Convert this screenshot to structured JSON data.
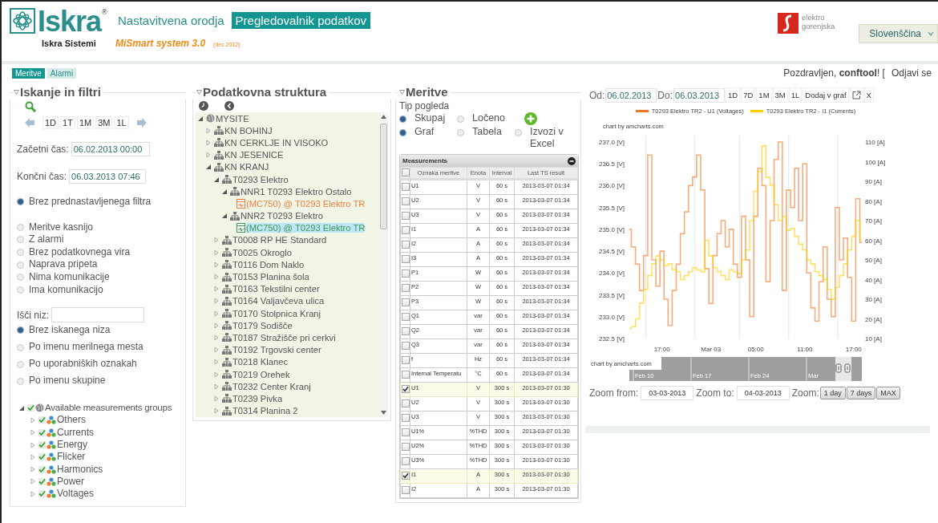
{
  "header": {
    "logo": {
      "name": "Iskra",
      "mark": "®",
      "subtitle": "Iskra Sistemi"
    },
    "tabs": [
      {
        "label": "Nastavitvena orodja",
        "selected": false
      },
      {
        "label": "Pregledovalnik podatkov",
        "selected": true
      }
    ],
    "product": "MiSmart system 3.0",
    "version": "(dec 2012)",
    "partner": [
      "elektro",
      "gorenjska"
    ],
    "language": "Slovenščina"
  },
  "nav": {
    "tabs": [
      {
        "label": "Meritve",
        "selected": true
      },
      {
        "label": "Alarmi",
        "selected": false
      }
    ],
    "greeting": "Pozdravljen, **conftool**! [",
    "logout": "Odjavi se"
  },
  "filters": {
    "title": "Iskanje in filtri",
    "period_buttons": [
      "1D",
      "1T",
      "1M",
      "3M",
      "1L"
    ],
    "start": {
      "label": "Začetni čas:",
      "value": "06.02.2013 00:00"
    },
    "end": {
      "label": "Končni čas:",
      "value": "06.03.2013 07:46"
    },
    "preset_options": [
      {
        "label": "Brez prednastavljenega filtra",
        "selected": true
      },
      {
        "label": "Meritve kasnijo",
        "selected": false
      },
      {
        "label": "Z alarmi",
        "selected": false
      },
      {
        "label": "Brez podatkovnega vira",
        "selected": false
      },
      {
        "label": "Naprava pripeta",
        "selected": false
      },
      {
        "label": "Nima komunikacije",
        "selected": false
      },
      {
        "label": "Ima komunikacijo",
        "selected": false
      }
    ],
    "search_label": "Išči niz:",
    "search_options": [
      {
        "label": "Brez iskanega niza",
        "selected": true
      },
      {
        "label": "Po imenu merilnega mesta",
        "selected": false
      },
      {
        "label": "Po uporabniških oznakah",
        "selected": false
      },
      {
        "label": "Po imenu skupine",
        "selected": false
      }
    ],
    "groups": [
      {
        "label": "Available measurements groups",
        "checked": true,
        "expanded": true,
        "children": [
          {
            "label": "Others",
            "checked": true,
            "expanded": false
          },
          {
            "label": "Currents",
            "checked": true,
            "expanded": false
          },
          {
            "label": "Energy",
            "checked": true,
            "expanded": false
          },
          {
            "label": "Flicker",
            "checked": true,
            "expanded": false
          },
          {
            "label": "Harmonics",
            "checked": true,
            "expanded": false
          },
          {
            "label": "Power",
            "checked": true,
            "expanded": false
          },
          {
            "label": "Voltages",
            "checked": true,
            "expanded": false
          }
        ]
      }
    ]
  },
  "structure": {
    "title": "Podatkovna struktura",
    "tree": [
      {
        "label": "MYSITE",
        "kind": "site",
        "expanded": true,
        "selected": false,
        "children": [
          {
            "label": "KN BOHINJ",
            "kind": "station",
            "expanded": false,
            "selected": false
          },
          {
            "label": "KN CERKLJE IN VISOKO",
            "kind": "station",
            "expanded": false,
            "selected": false
          },
          {
            "label": "KN JESENICE",
            "kind": "station",
            "expanded": false,
            "selected": false
          },
          {
            "label": "KN KRANJ",
            "kind": "station",
            "expanded": true,
            "selected": false,
            "children": [
              {
                "label": "T0293 Elektro",
                "kind": "station",
                "expanded": true,
                "selected": false,
                "children": [
                  {
                    "label": "NNR1 T0293 Elektro Ostalo",
                    "kind": "station",
                    "expanded": true,
                    "selected": false,
                    "children": [
                      {
                        "label": "(MC750) @ T0293 Elektro TR",
                        "kind": "device",
                        "color": "#f08040",
                        "selected": false
                      }
                    ]
                  },
                  {
                    "label": "NNR2 T0293 Elektro",
                    "kind": "station",
                    "expanded": true,
                    "selected": false,
                    "children": [
                      {
                        "label": "(MC750) @ T0293 Elektro TR",
                        "kind": "device",
                        "color": "#3c9a50",
                        "selected": true
                      }
                    ]
                  }
                ]
              },
              {
                "label": "T0008 RP HE Standard",
                "kind": "station",
                "expanded": false,
                "selected": false
              },
              {
                "label": "T0025 Okroglo",
                "kind": "station",
                "expanded": false,
                "selected": false
              },
              {
                "label": "T0116 Dom Naklo",
                "kind": "station",
                "expanded": false,
                "selected": false
              },
              {
                "label": "T0153 Planina šola",
                "kind": "station",
                "expanded": false,
                "selected": false
              },
              {
                "label": "T0163 Tekstilni center",
                "kind": "station",
                "expanded": false,
                "selected": false
              },
              {
                "label": "T0164 Valjavčeva ulica",
                "kind": "station",
                "expanded": false,
                "selected": false
              },
              {
                "label": "T0170 Stolpnica Kranj",
                "kind": "station",
                "expanded": false,
                "selected": false
              },
              {
                "label": "T0179 Sodišče",
                "kind": "station",
                "expanded": false,
                "selected": false
              },
              {
                "label": "T0187 Stražišče pri cerkvi",
                "kind": "station",
                "expanded": false,
                "selected": false
              },
              {
                "label": "T0192 Trgovski center",
                "kind": "station",
                "expanded": false,
                "selected": false
              },
              {
                "label": "T0218 Klanec",
                "kind": "station",
                "expanded": false,
                "selected": false
              },
              {
                "label": "T0219 Orehek",
                "kind": "station",
                "expanded": false,
                "selected": false
              },
              {
                "label": "T0232 Center Kranj",
                "kind": "station",
                "expanded": false,
                "selected": false
              },
              {
                "label": "T0239 Pivka",
                "kind": "station",
                "expanded": false,
                "selected": false
              },
              {
                "label": "T0314 Planina 2",
                "kind": "station",
                "expanded": false,
                "selected": false
              }
            ]
          }
        ]
      }
    ]
  },
  "measurements": {
    "title": "Meritve",
    "view_label": "Tip pogleda",
    "view_options": [
      {
        "label": "Skupaj",
        "selected": true
      },
      {
        "label": "Ločeno",
        "selected": false
      }
    ],
    "output_options": [
      {
        "label": "Graf",
        "selected": true
      },
      {
        "label": "Tabela",
        "selected": false
      },
      {
        "label": "Izvozi v Excel",
        "selected": false
      }
    ],
    "table": {
      "title": "Measurements",
      "header_checked": false,
      "columns": [
        "Oznaka meritve",
        "Enota",
        "Interval",
        "Last TS result"
      ],
      "rows": [
        {
          "name": "U1",
          "unit": "V",
          "interval": "60 s",
          "last": "2013-03-07 01:34",
          "checked": false
        },
        {
          "name": "U2",
          "unit": "V",
          "interval": "60 s",
          "last": "2013-03-07 01:34",
          "checked": false
        },
        {
          "name": "U3",
          "unit": "V",
          "interval": "60 s",
          "last": "2013-03-07 01:34",
          "checked": false
        },
        {
          "name": "I1",
          "unit": "A",
          "interval": "60 s",
          "last": "2013-03-07 01:34",
          "checked": false
        },
        {
          "name": "I2",
          "unit": "A",
          "interval": "60 s",
          "last": "2013-03-07 01:34",
          "checked": false
        },
        {
          "name": "I3",
          "unit": "A",
          "interval": "60 s",
          "last": "2013-03-07 01:34",
          "checked": false
        },
        {
          "name": "P1",
          "unit": "W",
          "interval": "60 s",
          "last": "2013-03-07 01:34",
          "checked": false
        },
        {
          "name": "P2",
          "unit": "W",
          "interval": "60 s",
          "last": "2013-03-07 01:34",
          "checked": false
        },
        {
          "name": "P3",
          "unit": "W",
          "interval": "60 s",
          "last": "2013-03-07 01:34",
          "checked": false
        },
        {
          "name": "Q1",
          "unit": "var",
          "interval": "60 s",
          "last": "2013-03-07 01:34",
          "checked": false
        },
        {
          "name": "Q2",
          "unit": "var",
          "interval": "60 s",
          "last": "2013-03-07 01:34",
          "checked": false
        },
        {
          "name": "Q3",
          "unit": "var",
          "interval": "60 s",
          "last": "2013-03-07 01:34",
          "checked": false
        },
        {
          "name": "f",
          "unit": "Hz",
          "interval": "60 s",
          "last": "2013-03-07 01:34",
          "checked": false
        },
        {
          "name": "Internal Temperatu",
          "unit": "°C",
          "interval": "60 s",
          "last": "2013-03-07 01:34",
          "checked": false
        },
        {
          "name": "U1",
          "unit": "V",
          "interval": "300 s",
          "last": "2013-03-07 01:30",
          "checked": true
        },
        {
          "name": "U2",
          "unit": "V",
          "interval": "300 s",
          "last": "2013-03-07 01:30",
          "checked": false
        },
        {
          "name": "U3",
          "unit": "V",
          "interval": "300 s",
          "last": "2013-03-07 01:30",
          "checked": false
        },
        {
          "name": "U1%",
          "unit": "%THD",
          "interval": "300 s",
          "last": "2013-03-07 01:30",
          "checked": false
        },
        {
          "name": "U2%",
          "unit": "%THD",
          "interval": "300 s",
          "last": "2013-03-07 01:30",
          "checked": false
        },
        {
          "name": "U3%",
          "unit": "%THD",
          "interval": "300 s",
          "last": "2013-03-07 01:30",
          "checked": false
        },
        {
          "name": "I1",
          "unit": "A",
          "interval": "300 s",
          "last": "2013-03-07 01:30",
          "checked": true
        },
        {
          "name": "I2",
          "unit": "A",
          "interval": "300 s",
          "last": "2013-03-07 01:30",
          "checked": false
        }
      ]
    }
  },
  "chart_panel": {
    "from_label": "Od:",
    "from": "06.02.2013",
    "to_label": "Do:",
    "to": "06.03.2013",
    "buttons": [
      "1D",
      "7D",
      "1M",
      "3M",
      "1L",
      "Dodaj v graf"
    ],
    "close": "X",
    "credit": "chart by amcharts.com",
    "chart_data": {
      "type": "line",
      "categories": [
        null,
        null,
        null,
        null,
        null,
        null,
        null,
        null,
        "17:00",
        null,
        null,
        null,
        null,
        null,
        null,
        null,
        null,
        null,
        null,
        null,
        "Mar 03",
        null,
        null,
        null,
        null,
        null,
        null,
        null,
        null,
        null,
        null,
        "05:00",
        null,
        null,
        null,
        null,
        null,
        null,
        null,
        null,
        null,
        null,
        null,
        "11:00",
        null,
        null,
        null,
        null,
        null,
        null,
        null,
        null,
        null,
        null,
        null,
        "17:00",
        null,
        null
      ],
      "ylim": [
        232.5,
        237
      ],
      "y2lim": [
        10,
        110
      ],
      "yticks": [
        {
          "value": 232.5,
          "label": "232.5 [V]"
        },
        {
          "value": 233,
          "label": "233.0 [V]"
        },
        {
          "value": 233.5,
          "label": "233.5 [V]"
        },
        {
          "value": 234,
          "label": "234.0 [V]"
        },
        {
          "value": 234.5,
          "label": "234.5 [V]"
        },
        {
          "value": 235,
          "label": "235.0 [V]"
        },
        {
          "value": 235.5,
          "label": "235.5 [V]"
        },
        {
          "value": 236,
          "label": "236.0 [V]"
        },
        {
          "value": 236.5,
          "label": "236.5 [V]"
        },
        {
          "value": 237,
          "label": "237.0 [V]"
        }
      ],
      "y2ticks": [
        {
          "value": 10,
          "label": "10 [A]"
        },
        {
          "value": 20,
          "label": "20 [A]"
        },
        {
          "value": 30,
          "label": "30 [A]"
        },
        {
          "value": 40,
          "label": "40 [A]"
        },
        {
          "value": 50,
          "label": "50 [A]"
        },
        {
          "value": 60,
          "label": "60 [A]"
        },
        {
          "value": 70,
          "label": "70 [A]"
        },
        {
          "value": 80,
          "label": "80 [A]"
        },
        {
          "value": 90,
          "label": "90 [A]"
        },
        {
          "value": 100,
          "label": "100 [A]"
        },
        {
          "value": 110,
          "label": "110 [A]"
        }
      ],
      "series": [
        {
          "name": "T0293 Elektro TR2 - U1 (Voltages)",
          "color": "#f27420",
          "axis": "y",
          "values": [
            235.0,
            234.6,
            234.2,
            233.6,
            234.4,
            236.7,
            234.3,
            233.7,
            234.5,
            233.4,
            232.8,
            233.6,
            234.2,
            234.9,
            235.4,
            236.0,
            236.2,
            236.7,
            235.9,
            234.1,
            233.3,
            234.4,
            234.9,
            235.2,
            234.6,
            235.0,
            234.2,
            233.9,
            235.3,
            234.3,
            233.0,
            235.3,
            236.4,
            236.0,
            233.8,
            235.2,
            236.6,
            237.0,
            233.6,
            235.9,
            235.5,
            236.4,
            235.2,
            236.5,
            234.0,
            233.2,
            232.9,
            233.8,
            234.6,
            233.4,
            233.0,
            235.5,
            234.3,
            234.8,
            233.9,
            232.9,
            235.7,
            234.7
          ]
        },
        {
          "name": "T0293 Elektro TR2 - I1 (Currents)",
          "color": "#ffcc00",
          "axis": "y2",
          "values": [
            15,
            16,
            20,
            28,
            35,
            42,
            48,
            52,
            50,
            47,
            48,
            45,
            44,
            40,
            42,
            44,
            46,
            45,
            44,
            60,
            52,
            46,
            44,
            42,
            40,
            45,
            44,
            43,
            50,
            55,
            70,
            85,
            95,
            108,
            92,
            88,
            78,
            70,
            72,
            65,
            66,
            62,
            58,
            55,
            50,
            48,
            44,
            42,
            40,
            35,
            30,
            36,
            42,
            48,
            55,
            62,
            70,
            60
          ]
        }
      ]
    },
    "navigator": {
      "credit": "chart by amcharts.com",
      "labels": [
        "Feb 10",
        "Feb 17",
        "Feb 24",
        "Mar"
      ]
    },
    "zoom": {
      "from_label": "Zoom from:",
      "from": "03-03-2013",
      "to_label": "Zoom to:",
      "to": "04-03-2013",
      "label": "Zoom:",
      "buttons": [
        "1 day",
        "7 days",
        "MAX"
      ]
    }
  }
}
